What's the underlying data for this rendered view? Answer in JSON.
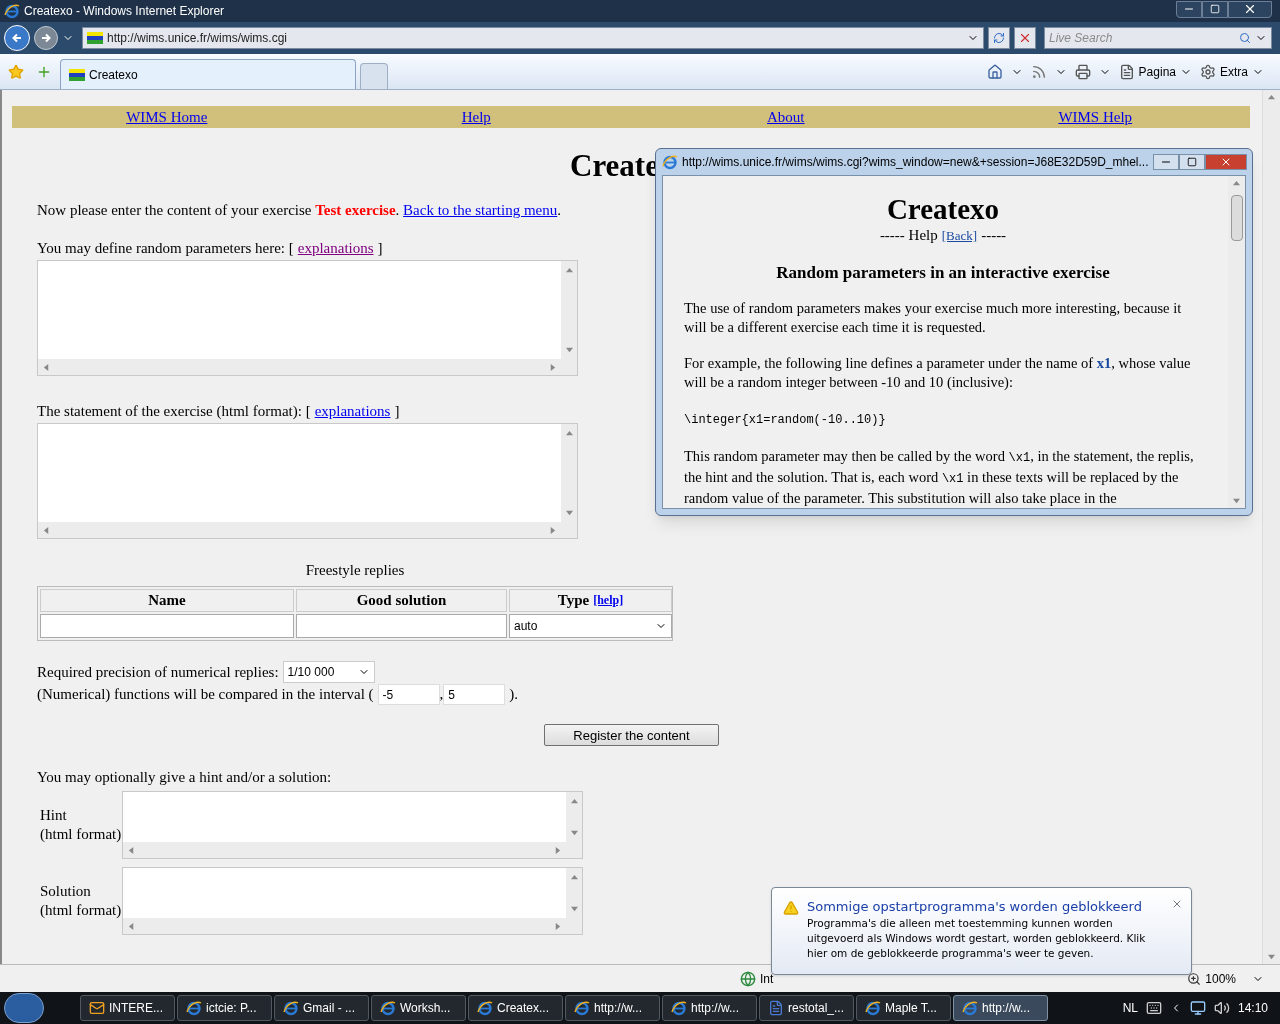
{
  "window": {
    "title": "Createxo - Windows Internet Explorer",
    "address": "http://wims.unice.fr/wims/wims.cgi",
    "search_placeholder": "Live Search"
  },
  "tabs": [
    {
      "label": "Createxo",
      "selected": true
    }
  ],
  "command_bar": [
    "Pagina",
    "Extra"
  ],
  "page": {
    "nav": [
      "WIMS Home",
      "Help",
      "About",
      "WIMS Help"
    ],
    "heading": "Create",
    "intro": {
      "text": "Now please enter the content of your exercise",
      "title": "Test exercise",
      "title_end": ".",
      "link": "Back to the starting menu",
      "end": "."
    },
    "random_params": {
      "label": "You may define random parameters here: [",
      "link": "explanations",
      "link_visited": true,
      "close": "]"
    },
    "statement": {
      "label": "The statement of the exercise (html format): [",
      "link": "explanations",
      "link_visited": false,
      "close": "]"
    },
    "freestyle": {
      "caption": "Freestyle replies",
      "columns": [
        "Name",
        "Good solution",
        "Type"
      ],
      "help_link": "[help]",
      "type_value": "auto"
    },
    "precision": {
      "label": "Required precision of numerical replies:",
      "value": "1/10 000"
    },
    "interval": {
      "label": "(Numerical) functions will be compared in the interval (",
      "from": "-5",
      "separator": ",",
      "to": "5",
      "close": ")."
    },
    "register_button": "Register the content",
    "hint_intro": "You may optionally give a hint and/or a solution:",
    "fields": [
      {
        "label": "Hint",
        "sub": "(html format)"
      },
      {
        "label": "Solution",
        "sub": "(html format)"
      }
    ]
  },
  "popup": {
    "title": "http://wims.unice.fr/wims/wims.cgi?wims_window=new&+session=J68E32D59D_mhel...",
    "heading": "Createxo",
    "help_prefix": "----- Help",
    "back": "[Back]",
    "help_suffix": "-----",
    "subheading": "Random parameters in an interactive exercise",
    "paragraphs": [
      [
        {
          "kind": "text",
          "text": "The use of random parameters makes your exercise much more interesting, because it will be a different exercise each time it is requested."
        }
      ],
      [
        {
          "kind": "text",
          "text": "For example, the following line defines a parameter under the name of "
        },
        {
          "kind": "var",
          "text": "x1"
        },
        {
          "kind": "text",
          "text": ", whose value will be a random integer between -10 and 10 (inclusive):"
        }
      ],
      [
        {
          "kind": "code",
          "text": "\\integer{x1=random(-10..10)}"
        }
      ],
      [
        {
          "kind": "text",
          "text": "This random parameter may then be called by the word "
        },
        {
          "kind": "code",
          "text": "\\x1"
        },
        {
          "kind": "text",
          "text": ", in the statement, the replis, the hint and the solution. That is, each word "
        },
        {
          "kind": "code",
          "text": "\\x1"
        },
        {
          "kind": "text",
          "text": " in these texts will be replaced by the random value of the parameter. This substitution will also take place in the"
        }
      ]
    ]
  },
  "notification": {
    "title": "Sommige opstartprogramma's worden geblokkeerd",
    "body": "Programma's die alleen met toestemming kunnen worden uitgevoerd als Windows wordt gestart, worden geblokkeerd. Klik hier om de geblokkeerde programma's weer te geven."
  },
  "status_bar": {
    "zone": "Int",
    "zoom": "100%"
  },
  "taskbar": {
    "items": [
      {
        "label": "INTERE...",
        "kind": "mail",
        "selected": false
      },
      {
        "label": "ictcie: P...",
        "kind": "ie",
        "selected": false
      },
      {
        "label": "Gmail - ...",
        "kind": "ie",
        "selected": false
      },
      {
        "label": "Worksh...",
        "kind": "ie",
        "selected": false
      },
      {
        "label": "Createx...",
        "kind": "ie",
        "selected": false
      },
      {
        "label": "http://w...",
        "kind": "ie",
        "selected": false
      },
      {
        "label": "http://w...",
        "kind": "ie",
        "selected": false
      },
      {
        "label": "restotal_...",
        "kind": "doc",
        "selected": false
      },
      {
        "label": "Maple T...",
        "kind": "ie",
        "selected": false
      },
      {
        "label": "http://w...",
        "kind": "ie",
        "selected": true
      }
    ],
    "language": "NL",
    "clock": "14:10"
  }
}
